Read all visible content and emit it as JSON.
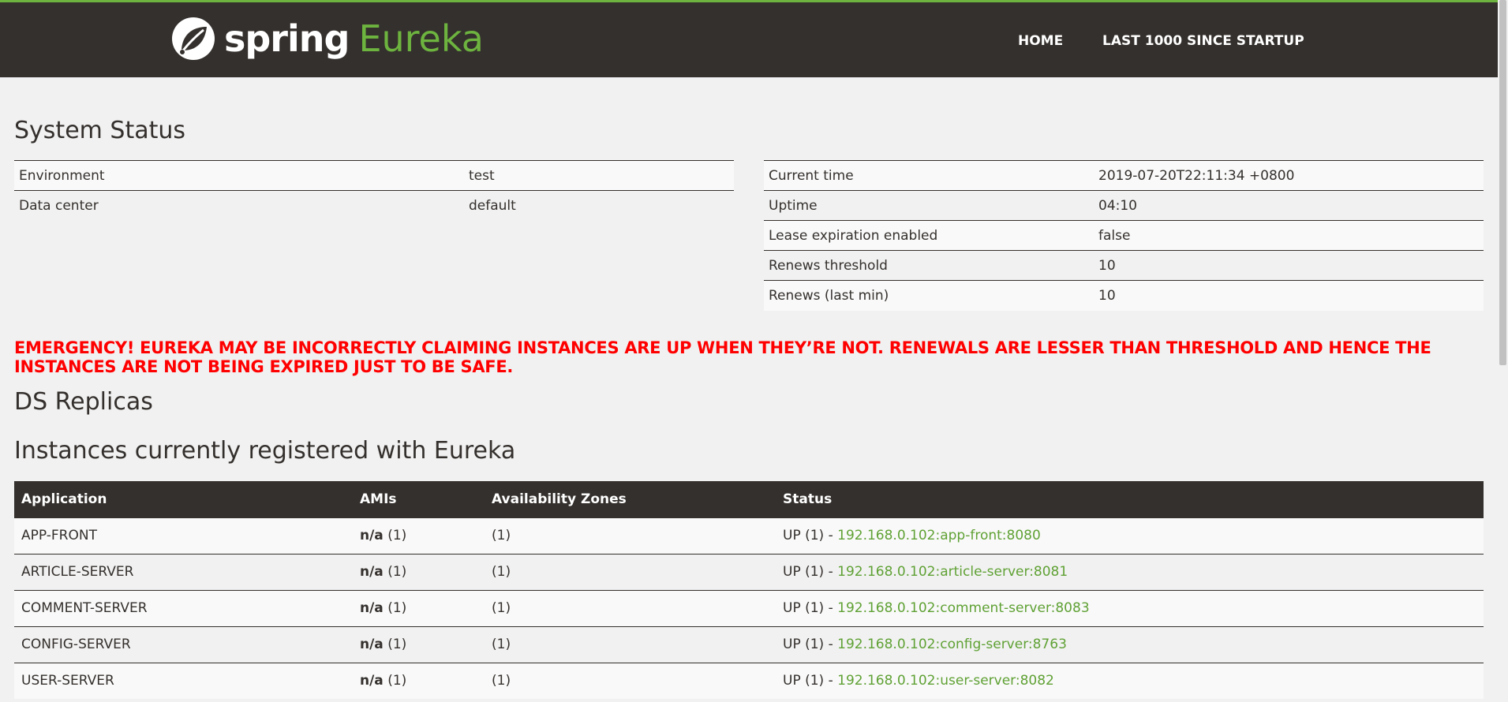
{
  "header": {
    "brand_spring": "spring",
    "brand_eureka": "Eureka",
    "nav": [
      "HOME",
      "LAST 1000 SINCE STARTUP"
    ]
  },
  "system_status": {
    "title": "System Status",
    "left": [
      {
        "label": "Environment",
        "value": "test"
      },
      {
        "label": "Data center",
        "value": "default"
      }
    ],
    "right": [
      {
        "label": "Current time",
        "value": "2019-07-20T22:11:34 +0800"
      },
      {
        "label": "Uptime",
        "value": "04:10"
      },
      {
        "label": "Lease expiration enabled",
        "value": "false"
      },
      {
        "label": "Renews threshold",
        "value": "10"
      },
      {
        "label": "Renews (last min)",
        "value": "10"
      }
    ]
  },
  "emergency": "EMERGENCY! EUREKA MAY BE INCORRECTLY CLAIMING INSTANCES ARE UP WHEN THEY’RE NOT. RENEWALS ARE LESSER THAN THRESHOLD AND HENCE THE INSTANCES ARE NOT BEING EXPIRED JUST TO BE SAFE.",
  "ds_replicas": {
    "title": "DS Replicas"
  },
  "instances": {
    "title": "Instances currently registered with Eureka",
    "columns": [
      "Application",
      "AMIs",
      "Availability Zones",
      "Status"
    ],
    "rows": [
      {
        "app": "APP-FRONT",
        "ami_na": "n/a",
        "ami_count": "(1)",
        "zones": "(1)",
        "status": "UP (1) - ",
        "instance": "192.168.0.102:app-front:8080"
      },
      {
        "app": "ARTICLE-SERVER",
        "ami_na": "n/a",
        "ami_count": "(1)",
        "zones": "(1)",
        "status": "UP (1) - ",
        "instance": "192.168.0.102:article-server:8081"
      },
      {
        "app": "COMMENT-SERVER",
        "ami_na": "n/a",
        "ami_count": "(1)",
        "zones": "(1)",
        "status": "UP (1) - ",
        "instance": "192.168.0.102:comment-server:8083"
      },
      {
        "app": "CONFIG-SERVER",
        "ami_na": "n/a",
        "ami_count": "(1)",
        "zones": "(1)",
        "status": "UP (1) - ",
        "instance": "192.168.0.102:config-server:8763"
      },
      {
        "app": "USER-SERVER",
        "ami_na": "n/a",
        "ami_count": "(1)",
        "zones": "(1)",
        "status": "UP (1) - ",
        "instance": "192.168.0.102:user-server:8082"
      }
    ]
  },
  "colors": {
    "header_bg": "#34302d",
    "accent": "#6db33f",
    "link": "#5fa134",
    "emergency": "#ff0000"
  },
  "icons": {
    "logo": "spring-leaf-icon"
  }
}
